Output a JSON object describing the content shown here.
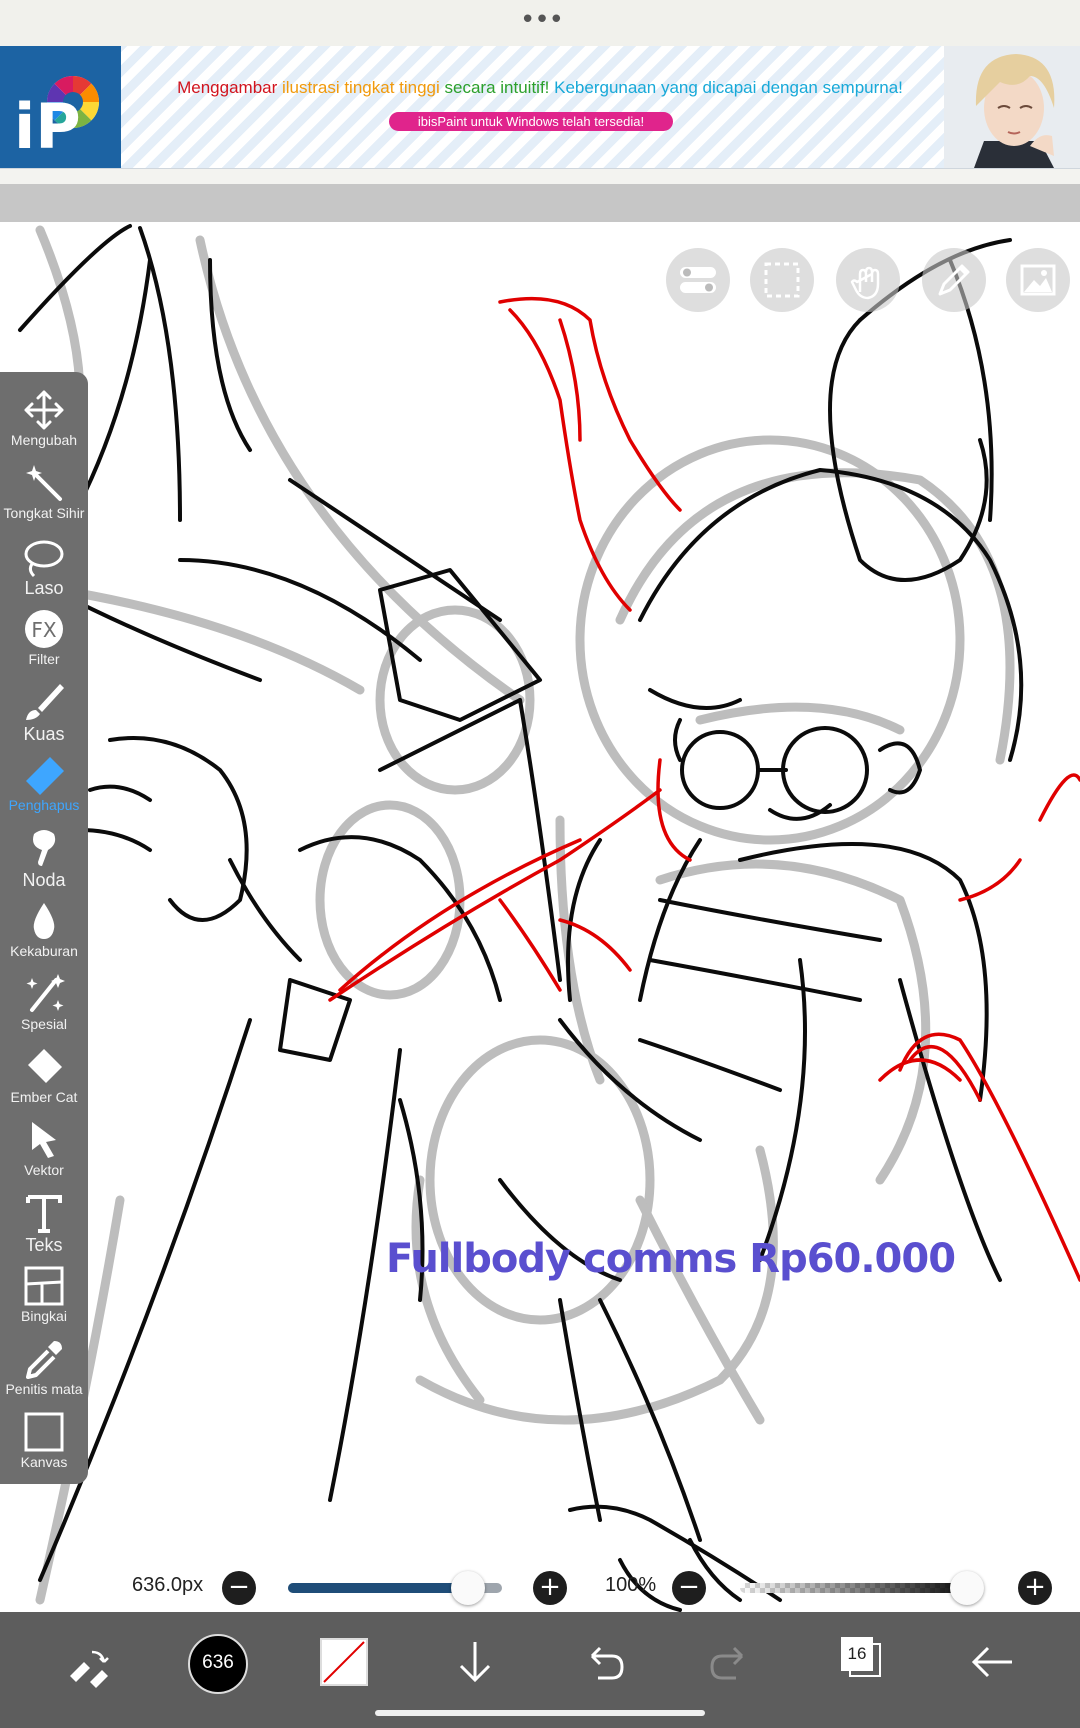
{
  "topbar": {
    "menu_dots": "•••"
  },
  "ad": {
    "logo_text": "iP",
    "headline_parts": [
      {
        "text": "Menggambar ",
        "color": "#d2141e"
      },
      {
        "text": "ilustrasi tingkat tinggi ",
        "color": "#f19a0c"
      },
      {
        "text": "secara intuitif! ",
        "color": "#2ca02c"
      },
      {
        "text": "Kebergunaan yang dicapai dengan sempurna!",
        "color": "#18a9d8"
      }
    ],
    "pill_text": "ibisPaint untuk Windows telah tersedia!"
  },
  "canvas": {
    "watermark": "Fullbody comms Rp60.000",
    "watermark_color": "#5a4fcf"
  },
  "top_tools": [
    "layer-toggle-icon",
    "selection-icon",
    "hand-icon",
    "pen-icon",
    "image-icon"
  ],
  "toolbar": {
    "items": [
      {
        "label": "Mengubah",
        "icon": "move-icon"
      },
      {
        "label": "Tongkat Sihir",
        "icon": "magic-wand-icon"
      },
      {
        "label": "Laso",
        "icon": "lasso-icon"
      },
      {
        "label": "Filter",
        "icon": "fx-icon"
      },
      {
        "label": "Kuas",
        "icon": "brush-icon"
      },
      {
        "label": "Penghapus",
        "icon": "eraser-icon",
        "active": true
      },
      {
        "label": "Noda",
        "icon": "smudge-icon"
      },
      {
        "label": "Kekaburan",
        "icon": "blur-icon"
      },
      {
        "label": "Spesial",
        "icon": "special-icon"
      },
      {
        "label": "Ember Cat",
        "icon": "paint-bucket-icon"
      },
      {
        "label": "Vektor",
        "icon": "vector-icon"
      },
      {
        "label": "Teks",
        "icon": "text-icon"
      },
      {
        "label": "Bingkai",
        "icon": "frame-icon"
      },
      {
        "label": "Penitis mata",
        "icon": "eyedropper-icon"
      },
      {
        "label": "Kanvas",
        "icon": "canvas-icon"
      }
    ],
    "active_color": "#3ea6ff"
  },
  "sliders": {
    "brush_size": "636.0px",
    "brush_size_fraction": 0.84,
    "opacity": "100%",
    "opacity_fraction": 1.0,
    "minus": "−",
    "plus": "+"
  },
  "bottombar": {
    "color_label": "636",
    "layer_count": "16"
  }
}
